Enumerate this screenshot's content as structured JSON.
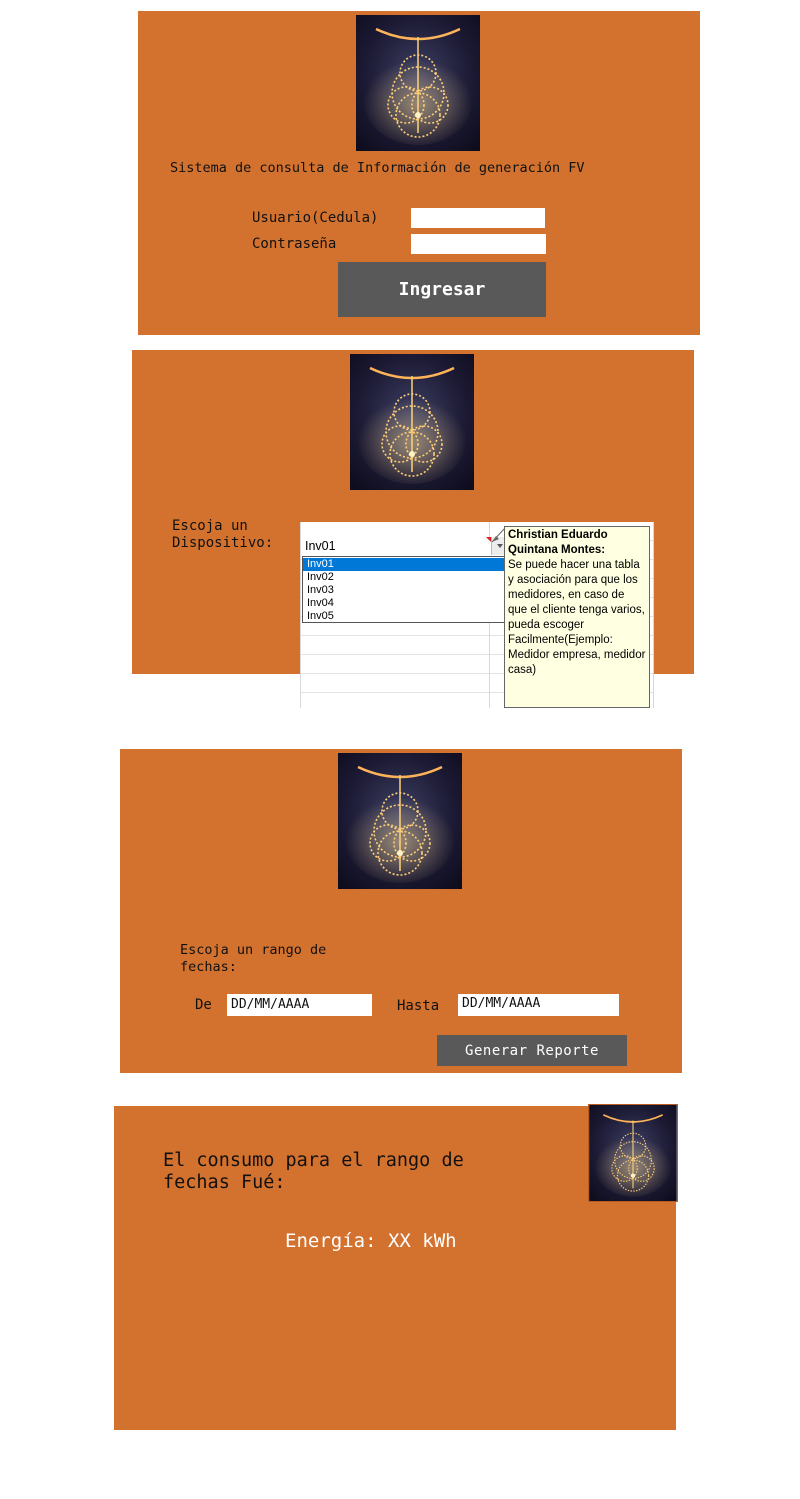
{
  "login": {
    "title": "Sistema de consulta de Información de generación FV",
    "user_label": "Usuario(Cedula)",
    "password_label": "Contraseña",
    "user_value": "",
    "password_value": "",
    "submit_label": "Ingresar"
  },
  "device": {
    "label_line1": "Escoja un",
    "label_line2": "Dispositivo:",
    "selected": "Inv01",
    "options": [
      "Inv01",
      "Inv02",
      "Inv03",
      "Inv04",
      "Inv05"
    ],
    "comment_author": "Christian Eduardo Quintana Montes:",
    "comment_text": "Se puede hacer una tabla y asociación para que los medidores, en caso de que el cliente tenga varios, pueda escoger Facilmente(Ejemplo: Medidor empresa, medidor casa)"
  },
  "dates": {
    "label_line1": "Escoja un rango de",
    "label_line2": "fechas:",
    "from_label": "De",
    "from_value": "DD/MM/AAAA",
    "to_label": "Hasta",
    "to_value": "DD/MM/AAAA",
    "generate_label": "Generar Reporte"
  },
  "result": {
    "heading_line1": "El consumo para el rango de",
    "heading_line2": "fechas Fué:",
    "energy_text": "Energía: XX kWh"
  },
  "colors": {
    "panel": "#D3722F",
    "button": "#595959",
    "selection": "#0078D7",
    "comment_bg": "#FFFFE1"
  }
}
